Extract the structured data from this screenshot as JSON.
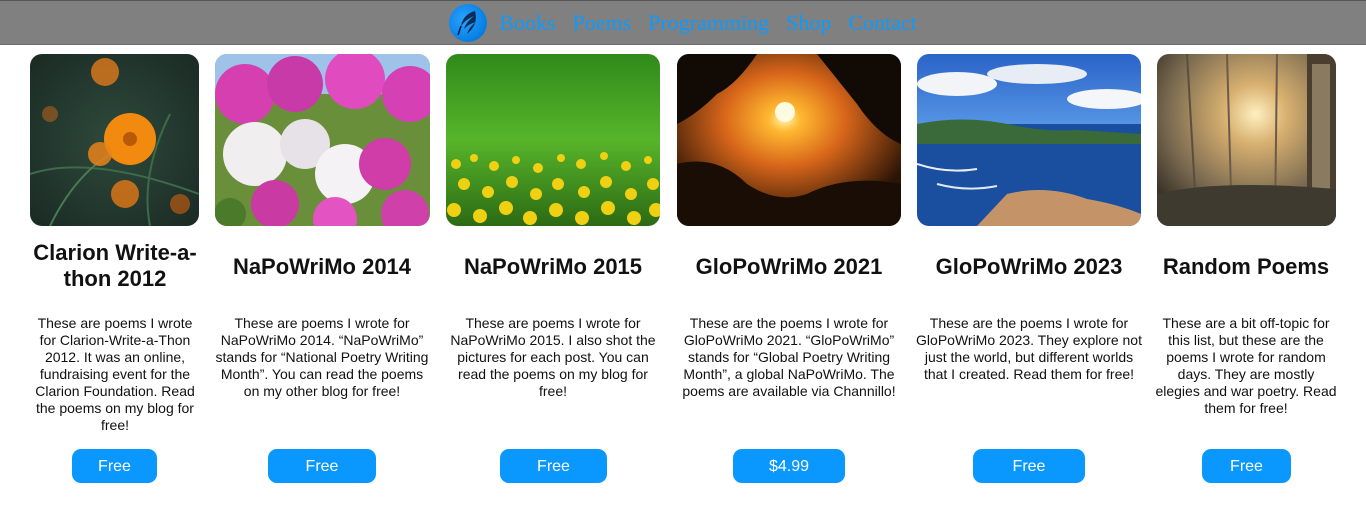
{
  "nav": {
    "logo_icon": "feather-logo-icon",
    "links": [
      "Books",
      "Poems",
      "Programming",
      "Shop",
      "Contact"
    ]
  },
  "colors": {
    "accent": "#0a98ff",
    "nav_bg": "#808080",
    "nav_link": "#0b9bff"
  },
  "cards": [
    {
      "title": "Clarion Write-a-thon 2012",
      "description": "These are poems I wrote for Clarion-Write-a-Thon 2012. It was an online, fundraising event for the Clarion Foundation. Read the poems on my blog for free!",
      "button": "Free"
    },
    {
      "title": "NaPoWriMo 2014",
      "description": "These are poems I wrote for NaPoWriMo 2014. “NaPoWriMo” stands for “National Poetry Writing Month”. You can read the poems on my other blog for free!",
      "button": "Free"
    },
    {
      "title": "NaPoWriMo 2015",
      "description": "These are poems I wrote for NaPoWriMo 2015. I also shot the pictures for each post. You can read the poems on my blog for free!",
      "button": "Free"
    },
    {
      "title": "GloPoWriMo 2021",
      "description": "These are the poems I wrote for GloPoWriMo 2021. “GloPoWriMo” stands for “Global Poetry Writing Month”, a global NaPoWriMo. The poems are available via Channillo!",
      "button": "$4.99"
    },
    {
      "title": "GloPoWriMo 2023",
      "description": "These are the poems I wrote for GloPoWriMo 2023. They explore not just the world, but different worlds that I created. Read them for free!",
      "button": "Free"
    },
    {
      "title": "Random Poems",
      "description": "These are a bit off-topic for this list, but these are the poems I wrote for random days. They are mostly elegies and war poetry. Read them for free!",
      "button": "Free"
    }
  ]
}
